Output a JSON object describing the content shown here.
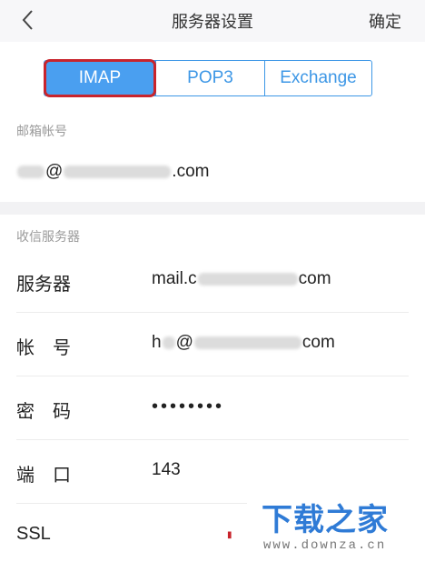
{
  "header": {
    "back_icon": "chevron-left-icon",
    "title": "服务器设置",
    "confirm_label": "确定"
  },
  "protocol_tabs": {
    "items": [
      {
        "label": "IMAP",
        "active": true
      },
      {
        "label": "POP3",
        "active": false
      },
      {
        "label": "Exchange",
        "active": false
      }
    ]
  },
  "account": {
    "section_label": "邮箱帐号",
    "email_prefix": "@",
    "email_suffix": ".com"
  },
  "incoming": {
    "section_label": "收信服务器",
    "server_label": "服务器",
    "server_value_prefix": "mail.c",
    "server_value_suffix": "com",
    "account_label": "帐　号",
    "account_value_prefix": "h",
    "account_value_mid": "@",
    "account_value_suffix": "com",
    "password_label": "密　码",
    "password_value": "••••••••",
    "port_label": "端　口",
    "port_value": "143",
    "ssl_label": "SSL"
  },
  "watermark": {
    "brand": "下载之家",
    "url": "www.downza.cn"
  },
  "colors": {
    "accent": "#4a9ff0",
    "highlight": "#c8242c",
    "watermark": "#2f7bd6"
  }
}
